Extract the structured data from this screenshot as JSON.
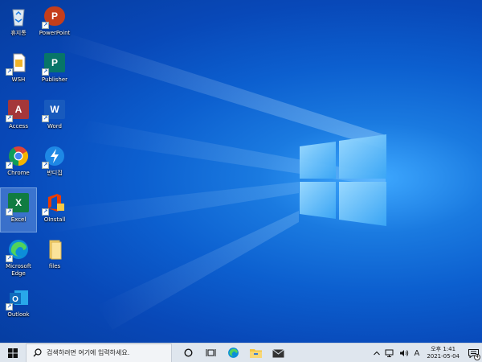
{
  "desktop": {
    "icons": [
      {
        "label": "휴지통",
        "icon": "recycle-bin-icon"
      },
      {
        "label": "PowerPoint",
        "icon": "powerpoint-icon",
        "letter": "P",
        "color": "#c43e1c"
      },
      {
        "label": "WSH",
        "icon": "script-file-icon"
      },
      {
        "label": "Publisher",
        "icon": "publisher-icon",
        "letter": "P",
        "color": "#077568"
      },
      {
        "label": "Access",
        "icon": "access-icon",
        "letter": "A",
        "color": "#a4373a"
      },
      {
        "label": "Word",
        "icon": "word-icon",
        "letter": "W",
        "color": "#185abd"
      },
      {
        "label": "Chrome",
        "icon": "chrome-icon"
      },
      {
        "label": "반디집",
        "icon": "bandizip-icon",
        "color": "#1e88e5"
      },
      {
        "label": "Excel",
        "icon": "excel-icon",
        "letter": "X",
        "color": "#107c41",
        "selected": true
      },
      {
        "label": "OInstall",
        "icon": "office-install-icon",
        "color": "#eb3c00"
      },
      {
        "label": "Microsoft Edge",
        "icon": "edge-icon"
      },
      {
        "label": "files",
        "icon": "folder-icon",
        "color": "#f8d775"
      },
      {
        "label": "Outlook",
        "icon": "outlook-icon",
        "letter": "O",
        "color": "#0f6cbd"
      }
    ]
  },
  "taskbar": {
    "search_placeholder": "검색하려면 여기에 입력하세요.",
    "buttons": [
      "cortana-circle-icon",
      "task-view-icon",
      "edge-icon",
      "file-explorer-icon",
      "mail-icon"
    ],
    "tray": {
      "chevron": "^",
      "ime": "A",
      "time": "오후 1:41",
      "date": "2021-05-04",
      "notification_count": "4"
    }
  },
  "colors": {
    "wallpaper": "#0c5fcf",
    "taskbar": "#dfe6ee"
  }
}
